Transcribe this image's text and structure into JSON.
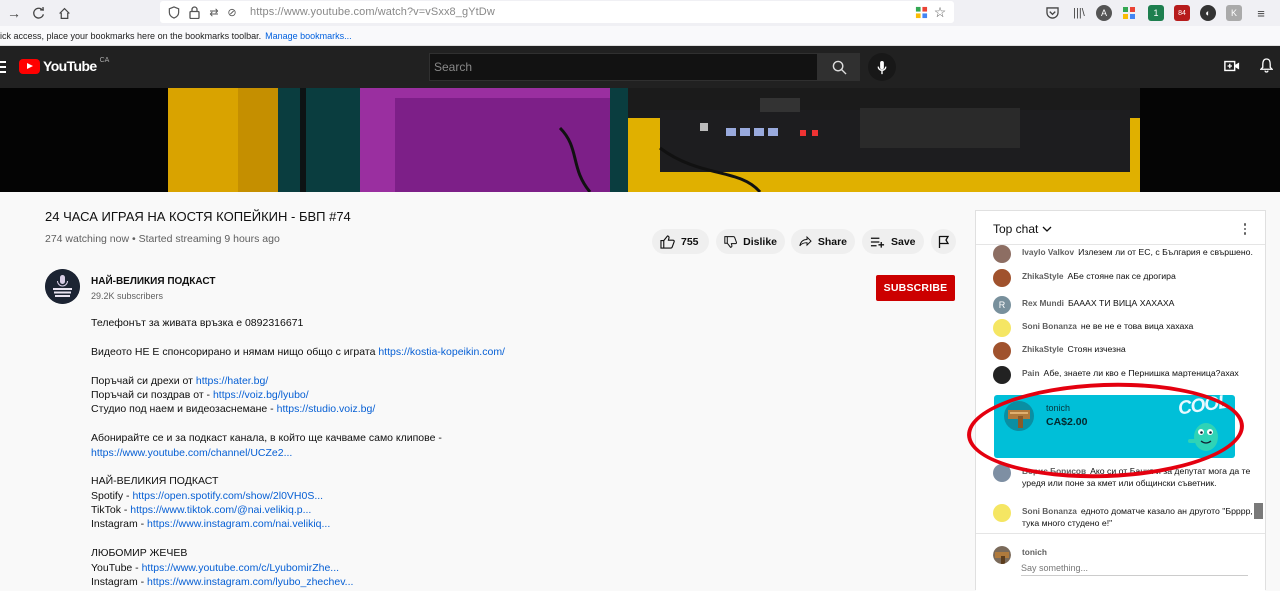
{
  "browser": {
    "url": "https://www.youtube.com/watch?v=vSxx8_gYtDw",
    "bookmarks_text": "ick access, place your bookmarks here on the bookmarks toolbar.",
    "manage_bookmarks": "Manage bookmarks...",
    "badge_count_1": "1",
    "badge_count_2": "84"
  },
  "header": {
    "logo_text": "YouTube",
    "country": "CA",
    "search_placeholder": "Search"
  },
  "video": {
    "title": "24 ЧАСА ИГРАЯ НА КОСТЯ КОПЕЙКИН - БВП #74",
    "meta": "274 watching now • Started streaming 9 hours ago",
    "likes": "755",
    "dislike_label": "Dislike",
    "share_label": "Share",
    "save_label": "Save"
  },
  "channel": {
    "name": "НАЙ-ВЕЛИКИЯ ПОДКАСТ",
    "subscribers": "29.2K subscribers",
    "subscribe_label": "SUBSCRIBE"
  },
  "description": [
    {
      "text": "Телефонът за живата връзка е 0892316671",
      "link": ""
    },
    {
      "text": "",
      "link": ""
    },
    {
      "text": "Видеото НЕ Е спонсорирано и нямам нищо общо с играта ",
      "link": "https://kostia-kopeikin.com/"
    },
    {
      "text": "",
      "link": ""
    },
    {
      "text": "Поръчай си дрехи от ",
      "link": "https://hater.bg/"
    },
    {
      "text": "Поръчай си поздрав от - ",
      "link": "https://voiz.bg/lyubo/"
    },
    {
      "text": "Студио под наем и видеозаснемане - ",
      "link": "https://studio.voiz.bg/"
    },
    {
      "text": "",
      "link": ""
    },
    {
      "text": "Абонирайте се и за подкаст канала, в който ще качваме само клипове -",
      "link": ""
    },
    {
      "text": "",
      "link": "https://www.youtube.com/channel/UCZe2..."
    },
    {
      "text": "",
      "link": ""
    },
    {
      "text": "НАЙ-ВЕЛИКИЯ ПОДКАСТ",
      "link": ""
    },
    {
      "text": "Spotify - ",
      "link": "https://open.spotify.com/show/2l0VH0S..."
    },
    {
      "text": "TikTok - ",
      "link": "https://www.tiktok.com/@nai.velikiq.p..."
    },
    {
      "text": "Instagram - ",
      "link": "https://www.instagram.com/nai.velikiq..."
    },
    {
      "text": "",
      "link": ""
    },
    {
      "text": "ЛЮБОМИР ЖЕЧЕВ",
      "link": ""
    },
    {
      "text": "YouTube - ",
      "link": "https://www.youtube.com/c/LyubomirZhe..."
    },
    {
      "text": "Instagram - ",
      "link": "https://www.instagram.com/lyubo_zhechev..."
    }
  ],
  "chat": {
    "mode_label": "Top chat",
    "messages": [
      {
        "author": "Ivaylo Valkov",
        "text": "Излезем ли от ЕС, с България е свършено.",
        "avatar_color": "#8d6e63"
      },
      {
        "author": "ZhikaStyle",
        "text": "АБе стояне пак се дрогира",
        "avatar_color": "#a0522d"
      },
      {
        "author": "Rex Mundi",
        "text": "БАААХ ТИ ВИЦА ХАХАХА",
        "avatar_color": "#78909c",
        "avatar_letter": "R"
      },
      {
        "author": "Soni Bonanza",
        "text": "не ве не е това вица хахаха",
        "avatar_color": "#f5e663"
      },
      {
        "author": "ZhikaStyle",
        "text": "Стоян изчезна",
        "avatar_color": "#a0522d"
      },
      {
        "author": "Pain",
        "text": "Абе, знаете ли кво е Пернишка мартеница?ахах",
        "avatar_color": "#222222"
      },
      {
        "author": "Борис Борисов",
        "text": "Ако си от Банкя и за депутат мога да те уредя или поне за кмет или общински съветник.",
        "avatar_color": "#7e8fa3"
      },
      {
        "author": "Soni Bonanza",
        "text": "едното доматче казало ан другото \"Брррр, тука много студено е!\"",
        "avatar_color": "#f5e663"
      }
    ],
    "superchat": {
      "author": "tonich",
      "amount": "CA$2.00",
      "sticker_text": "COOL",
      "color": "#00bfd8"
    },
    "current_user": "tonich",
    "input_placeholder": "Say something..."
  }
}
